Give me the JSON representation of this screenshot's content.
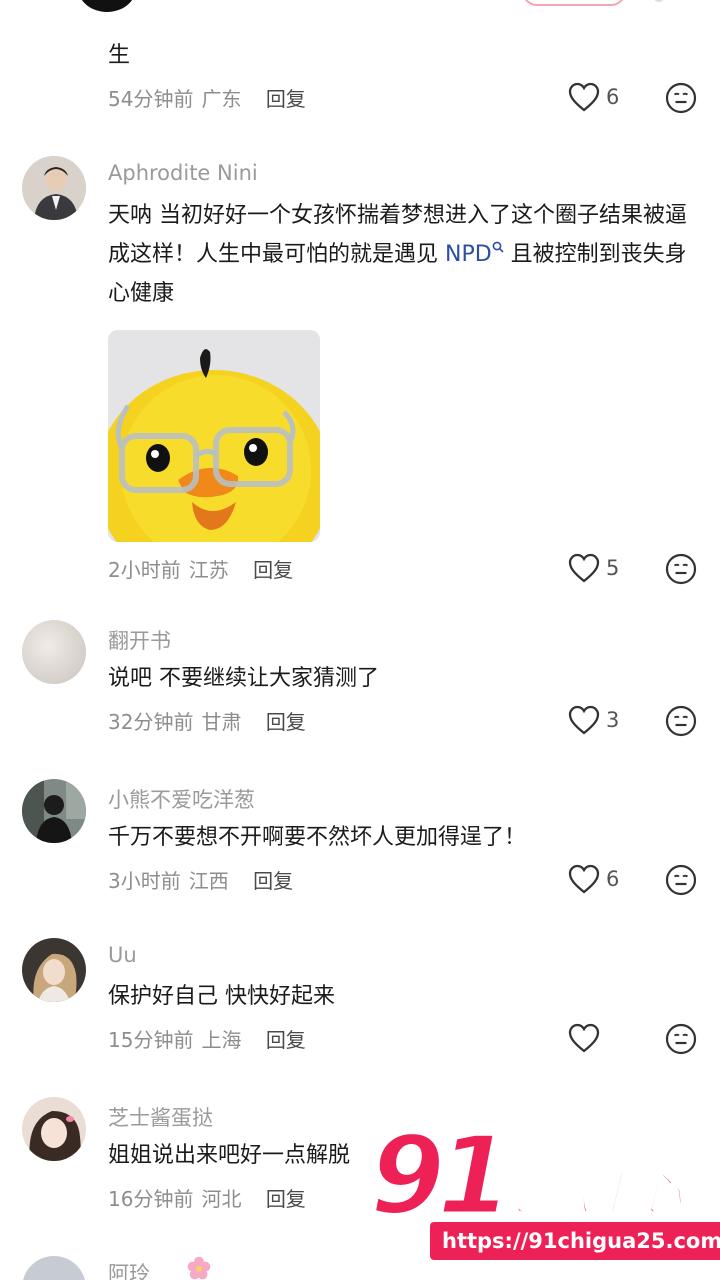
{
  "colors": {
    "accent": "#ee2157",
    "link": "#2c4ea3",
    "meta": "#8d8d8d"
  },
  "icons": {
    "like": "heart-outline-icon",
    "emoji": "neutral-face-icon",
    "search": "search-icon"
  },
  "top_comment": {
    "text": "生",
    "time": "54分钟前",
    "location": "广东",
    "reply": "回复",
    "likes": "6"
  },
  "comments": [
    {
      "username": "Aphrodite Nini",
      "text_before": "天呐 当初好好一个女孩怀揣着梦想进入了这个圈子结果被逼成这样！人生中最可怕的就是遇见 ",
      "link": "NPD",
      "text_after": " 且被控制到丧失身心健康",
      "time": "2小时前",
      "location": "江苏",
      "reply": "回复",
      "likes": "5"
    },
    {
      "username": "翻开书",
      "text": "说吧 不要继续让大家猜测了",
      "time": "32分钟前",
      "location": "甘肃",
      "reply": "回复",
      "likes": "3"
    },
    {
      "username": "小熊不爱吃洋葱",
      "text": "千万不要想不开啊要不然坏人更加得逞了！",
      "time": "3小时前",
      "location": "江西",
      "reply": "回复",
      "likes": "6"
    },
    {
      "username": "Uu",
      "text": "保护好自己 快快好起来",
      "time": "15分钟前",
      "location": "上海",
      "reply": "回复",
      "likes": ""
    },
    {
      "username": "芝士酱蛋挞",
      "text": "姐姐说出来吧好一点解脱",
      "time": "16分钟前",
      "location": "河北",
      "reply": "回复",
      "likes": ""
    },
    {
      "username": "阿玲"
    }
  ],
  "watermark": {
    "number": "91",
    "name": "吃瓜中心",
    "url": "https://91chigua25.com"
  }
}
